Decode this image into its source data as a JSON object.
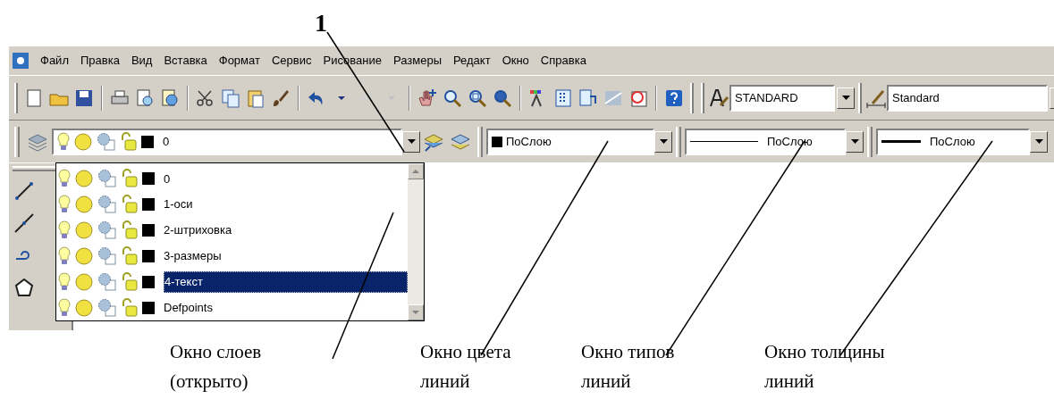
{
  "callout_number": "1",
  "menu": [
    "Файл",
    "Правка",
    "Вид",
    "Вставка",
    "Формат",
    "Сервис",
    "Рисование",
    "Размеры",
    "Редакт",
    "Окно",
    "Справка"
  ],
  "styles_toolbar": {
    "text_style": "STANDARD",
    "dim_style": "Standard"
  },
  "layers_toolbar": {
    "current_layer": "0"
  },
  "layer_list": [
    {
      "name": "0",
      "selected": false
    },
    {
      "name": "1-оси",
      "selected": false
    },
    {
      "name": "2-штриховка",
      "selected": false
    },
    {
      "name": "3-размеры",
      "selected": false
    },
    {
      "name": "4-текст",
      "selected": true
    },
    {
      "name": "Defpoints",
      "selected": false
    }
  ],
  "properties_toolbar": {
    "color_value": "ПоСлою",
    "linetype": "ПоСлою",
    "lineweight": "ПоСлою"
  },
  "captions": [
    {
      "lines": [
        "Окно слоев",
        "(открыто)"
      ]
    },
    {
      "lines": [
        "Окно цвета",
        "линий"
      ]
    },
    {
      "lines": [
        "Окно типов",
        "линий"
      ]
    },
    {
      "lines": [
        "Окно толщины",
        "линий"
      ]
    }
  ]
}
